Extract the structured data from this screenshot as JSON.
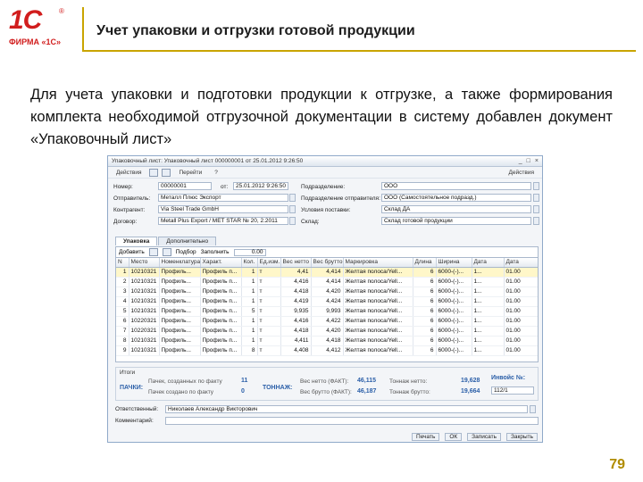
{
  "logo": {
    "mark": "1С",
    "reg": "®",
    "firm": "ФИРМА «1С»"
  },
  "slide": {
    "title": "Учет упаковки и отгрузки готовой продукции",
    "description": "Для учета упаковки и подготовки продукции к отгрузке, а также формирования комплекта необходимой отгрузочной документации в систему добавлен документ «Упаковочный лист»",
    "page_number": "79"
  },
  "window": {
    "title": "Упаковочный лист: Упаковочный лист 000000001 от 25.01.2012 9:26:50",
    "toolbar": {
      "actions": "Действия",
      "go": "Перейти",
      "help": "?",
      "right": "Действия"
    },
    "form": {
      "number_label": "Номер:",
      "number_value": "00000001",
      "date_label": "от:",
      "date_value": "25.01.2012 9:26:50",
      "division_label": "Подразделение:",
      "division_value": "ООО",
      "sender_label": "Отправитель:",
      "sender_value": "Металл Плюс Экспорт",
      "resp_label": "Подразделение отправителя:",
      "resp_value": "ООО (Самостоятельное подразд.)",
      "contractor_label": "Контрагент:",
      "contractor_value": "Via Steel Trade GmbH",
      "delivery_label": "Условия поставки:",
      "delivery_value": "Склад ДА",
      "contract_label": "Договор:",
      "contract_value": "Metall Plus Export / MET STAR № 20, 2.2011",
      "warehouse_label": "Склад:",
      "warehouse_value": "Склад готовой продукции"
    },
    "tabs": [
      "Упаковка",
      "Дополнительно"
    ],
    "table_toolbar": {
      "add": "Добавить",
      "pick": "Подбор",
      "fill": "Заполнить",
      "qty": "0.00"
    },
    "columns": [
      "N",
      "Место",
      "Номенклатура",
      "Характ.",
      "Кол.",
      "Ед.изм.",
      "Вес нетто",
      "Вес брутто",
      "Маркировка",
      "Длина",
      "Ширина",
      "Дата",
      "Дата"
    ],
    "rows": [
      [
        "1",
        "10210321",
        "Профиль...",
        "Профиль п...",
        "1",
        "т",
        "4,41",
        "4,414",
        "Желтая полоса/Yell...",
        "6",
        "6000-(-)...",
        "1...",
        "01.00"
      ],
      [
        "2",
        "10210321",
        "Профиль...",
        "Профиль п...",
        "1",
        "т",
        "4,416",
        "4,414",
        "Желтая полоса/Yell...",
        "6",
        "6000-(-)...",
        "1...",
        "01.00"
      ],
      [
        "3",
        "10210321",
        "Профиль...",
        "Профиль п...",
        "1",
        "т",
        "4,418",
        "4,420",
        "Желтая полоса/Yell...",
        "6",
        "6000-(-)...",
        "1...",
        "01.00"
      ],
      [
        "4",
        "10210321",
        "Профиль...",
        "Профиль п...",
        "1",
        "т",
        "4,419",
        "4,424",
        "Желтая полоса/Yell...",
        "6",
        "6000-(-)...",
        "1...",
        "01.00"
      ],
      [
        "5",
        "10210321",
        "Профиль...",
        "Профиль п...",
        "5",
        "т",
        "9,935",
        "9,993",
        "Желтая полоса/Yell...",
        "6",
        "6000-(-)...",
        "1...",
        "01.00"
      ],
      [
        "6",
        "10220321",
        "Профиль...",
        "Профиль п...",
        "1",
        "т",
        "4,416",
        "4,422",
        "Желтая полоса/Yell...",
        "6",
        "6000-(-)...",
        "1...",
        "01.00"
      ],
      [
        "7",
        "10220321",
        "Профиль...",
        "Профиль п...",
        "1",
        "т",
        "4,418",
        "4,420",
        "Желтая полоса/Yell...",
        "6",
        "6000-(-)...",
        "1...",
        "01.00"
      ],
      [
        "8",
        "10210321",
        "Профиль...",
        "Профиль п...",
        "1",
        "т",
        "4,411",
        "4,418",
        "Желтая полоса/Yell...",
        "6",
        "6000-(-)...",
        "1...",
        "01.00"
      ],
      [
        "9",
        "10210321",
        "Профиль...",
        "Профиль п...",
        "8",
        "т",
        "4,408",
        "4,412",
        "Желтая полоса/Yell...",
        "6",
        "6000-(-)...",
        "1...",
        "01.00"
      ]
    ],
    "totals": {
      "caption": "Итоги",
      "packs_label": "ПАЧКИ:",
      "packs_line1": "Пачек, созданных по факту",
      "packs_val1": "11",
      "packs_line2": "Пачек создано по факту",
      "packs_val2": "0",
      "tonnage_label": "ТОННАЖ:",
      "net_label": "Вес нетто (ФАКТ):",
      "net_value": "46,115",
      "gross_label": "Вес брутто (ФАКТ):",
      "gross_value": "46,187",
      "net_contract_label": "Тоннаж нетто:",
      "net_contract_value": "19,628",
      "gross_contract_label": "Тоннаж брутто:",
      "gross_contract_value": "19,664",
      "invoice_label": "Инвойс №:",
      "invoice_value": "112/1"
    },
    "responsible_label": "Ответственный:",
    "responsible_value": "Николаев Александр Викторович",
    "comment_label": "Комментарий:",
    "buttons": {
      "print": "Печать",
      "ok": "ОК",
      "write": "Записать",
      "close": "Закрыть"
    }
  }
}
